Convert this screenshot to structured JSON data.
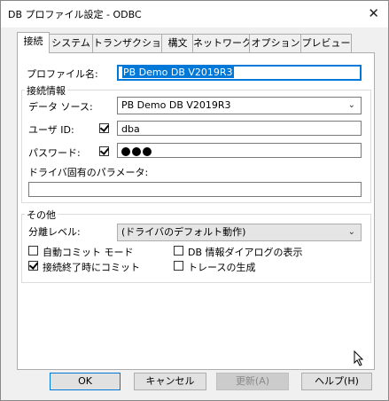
{
  "window": {
    "title": "DB プロファイル設定 - ODBC",
    "close_glyph": "✕"
  },
  "tabs": [
    {
      "label": "接続"
    },
    {
      "label": "システム"
    },
    {
      "label": "トランザクション"
    },
    {
      "label": "構文"
    },
    {
      "label": "ネットワーク"
    },
    {
      "label": "オプション"
    },
    {
      "label": "プレビュー"
    }
  ],
  "profile": {
    "label": "プロファイル名:",
    "value": "PB Demo DB V2019R3"
  },
  "connection": {
    "group_label": "接続情報",
    "datasource_label": "データ ソース:",
    "datasource_value": "PB Demo DB V2019R3",
    "userid_label": "ユーザ ID:",
    "userid_checked": true,
    "userid_value": "dba",
    "password_label": "パスワード:",
    "password_checked": true,
    "driver_params_label": "ドライバ固有のパラメータ:",
    "driver_params_value": ""
  },
  "other": {
    "group_label": "その他",
    "isolation_label": "分離レベル:",
    "isolation_value": "(ドライバのデフォルト動作)",
    "auto_commit_label": "自動コミット モード",
    "auto_commit_checked": false,
    "commit_on_disconnect_label": "接続終了時にコミット",
    "commit_on_disconnect_checked": true,
    "db_info_dialog_label": "DB 情報ダイアログの表示",
    "db_info_dialog_checked": false,
    "trace_label": "トレースの生成",
    "trace_checked": false
  },
  "buttons": {
    "ok": "OK",
    "cancel": "キャンセル",
    "apply": "更新(A)",
    "help": "ヘルプ(H)"
  },
  "icons": {
    "chevron": "chevron-down-icon",
    "check": "check-icon",
    "close": "close-icon"
  },
  "colors": {
    "accent": "#0078d7",
    "background": "#f0f0f0",
    "panel": "#ffffff"
  }
}
